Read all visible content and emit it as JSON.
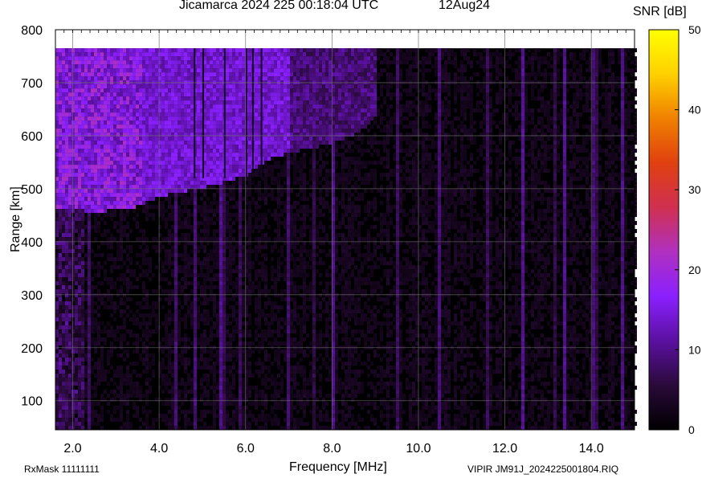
{
  "header": {
    "title": "Jicamarca 2024 225 00:18:04 UTC",
    "date": "12Aug24"
  },
  "footer": {
    "left": "RxMask 11111111",
    "right": "VIPIR  JM91J_2024225001804.RIQ"
  },
  "chart_data": {
    "type": "heatmap",
    "title": "Jicamarca 2024 225 00:18:04 UTC",
    "xlabel": "Frequency [MHz]",
    "ylabel": "Range [km]",
    "xlim": [
      1.6,
      15.0
    ],
    "ylim": [
      45,
      800
    ],
    "x_ticks": [
      2.0,
      4.0,
      6.0,
      8.0,
      10.0,
      12.0,
      14.0
    ],
    "x_tick_labels": [
      "2.0",
      "4.0",
      "6.0",
      "8.0",
      "10.0",
      "12.0",
      "14.0"
    ],
    "y_ticks": [
      100,
      200,
      300,
      400,
      500,
      600,
      700,
      800
    ],
    "y_tick_labels": [
      "100",
      "200",
      "300",
      "400",
      "500",
      "600",
      "700",
      "800"
    ],
    "grid": true,
    "colorbar": {
      "label": "SNR [dB]",
      "range": [
        0,
        50
      ],
      "ticks": [
        0,
        10,
        20,
        30,
        40,
        50
      ],
      "tick_labels": [
        "0",
        "10",
        "20",
        "30",
        "40",
        "50"
      ],
      "colors": [
        "#000000",
        "#2a0a3a",
        "#5a10a0",
        "#8a20ff",
        "#b030c0",
        "#d03050",
        "#e04010",
        "#f08000",
        "#ffd000",
        "#ffff00"
      ]
    },
    "data_max_range_km": 765,
    "echo_trace": [
      {
        "frequency_mhz": 1.7,
        "range_km": 465
      },
      {
        "frequency_mhz": 2.5,
        "range_km": 460
      },
      {
        "frequency_mhz": 3.3,
        "range_km": 465
      },
      {
        "frequency_mhz": 4.0,
        "range_km": 490
      },
      {
        "frequency_mhz": 5.0,
        "range_km": 505
      },
      {
        "frequency_mhz": 6.0,
        "range_km": 530
      },
      {
        "frequency_mhz": 6.5,
        "range_km": 560
      },
      {
        "frequency_mhz": 7.2,
        "range_km": 575
      },
      {
        "frequency_mhz": 8.0,
        "range_km": 590
      },
      {
        "frequency_mhz": 8.6,
        "range_km": 610
      },
      {
        "frequency_mhz": 9.0,
        "range_km": 640
      }
    ]
  }
}
